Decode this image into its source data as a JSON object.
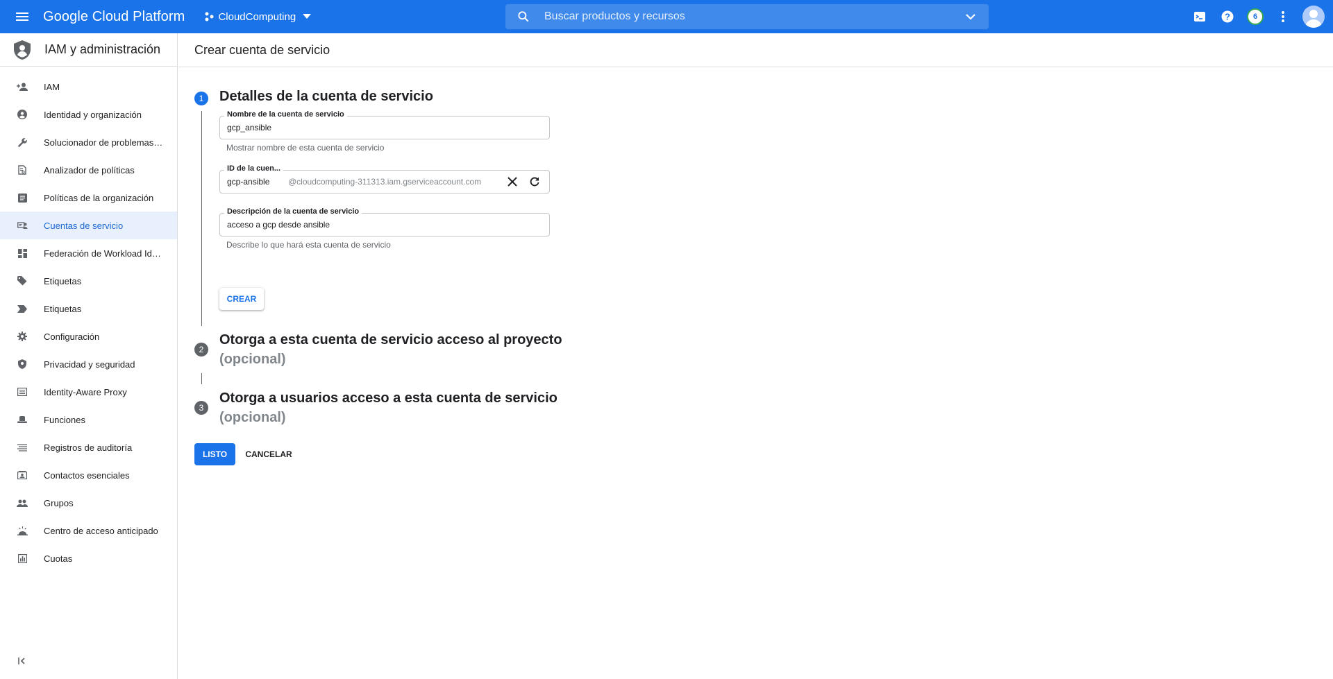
{
  "topbar": {
    "brand": "Google Cloud Platform",
    "project_name": "CloudComputing",
    "search_placeholder": "Buscar productos y recursos",
    "notification_count": "6"
  },
  "sidebar": {
    "title": "IAM y administración",
    "items": [
      {
        "label": "IAM",
        "icon": "person-add-icon"
      },
      {
        "label": "Identidad y organización",
        "icon": "account-circle-icon"
      },
      {
        "label": "Solucionador de problemas ...",
        "icon": "wrench-icon"
      },
      {
        "label": "Analizador de políticas",
        "icon": "policy-analyzer-icon"
      },
      {
        "label": "Políticas de la organización",
        "icon": "document-list-icon"
      },
      {
        "label": "Cuentas de servicio",
        "icon": "service-account-icon",
        "active": true
      },
      {
        "label": "Federación de Workload Ide...",
        "icon": "dashboard-icon"
      },
      {
        "label": "Etiquetas",
        "icon": "tag-icon"
      },
      {
        "label": "Etiquetas",
        "icon": "label-icon"
      },
      {
        "label": "Configuración",
        "icon": "gear-icon"
      },
      {
        "label": "Privacidad y seguridad",
        "icon": "shield-icon"
      },
      {
        "label": "Identity-Aware Proxy",
        "icon": "proxy-list-icon"
      },
      {
        "label": "Funciones",
        "icon": "hat-icon"
      },
      {
        "label": "Registros de auditoría",
        "icon": "lines-list-icon"
      },
      {
        "label": "Contactos esenciales",
        "icon": "contact-card-icon"
      },
      {
        "label": "Grupos",
        "icon": "people-icon"
      },
      {
        "label": "Centro de acceso anticipado",
        "icon": "early-access-icon"
      },
      {
        "label": "Cuotas",
        "icon": "quota-icon"
      }
    ]
  },
  "main": {
    "page_title": "Crear cuenta de servicio",
    "step1": {
      "number": "1",
      "title": "Detalles de la cuenta de servicio",
      "name_field": {
        "label": "Nombre de la cuenta de servicio",
        "value": "gcp_ansible",
        "hint": "Mostrar nombre de esta cuenta de servicio"
      },
      "id_field": {
        "label": "ID de la cuen...",
        "value": "gcp-ansible",
        "suffix": "@cloudcomputing-311313.iam.gserviceaccount.com"
      },
      "desc_field": {
        "label": "Descripción de la cuenta de servicio",
        "value": "acceso a gcp desde ansible",
        "hint": "Describe lo que hará esta cuenta de servicio"
      },
      "create_label": "CREAR"
    },
    "step2": {
      "number": "2",
      "title": "Otorga a esta cuenta de servicio acceso al proyecto",
      "optional": "(opcional)"
    },
    "step3": {
      "number": "3",
      "title": "Otorga a usuarios acceso a esta cuenta de servicio",
      "optional": "(opcional)"
    },
    "done_label": "LISTO",
    "cancel_label": "CANCELAR"
  },
  "colors": {
    "accent": "#1a73e8",
    "active_item_bg": "#e8f0fe"
  }
}
